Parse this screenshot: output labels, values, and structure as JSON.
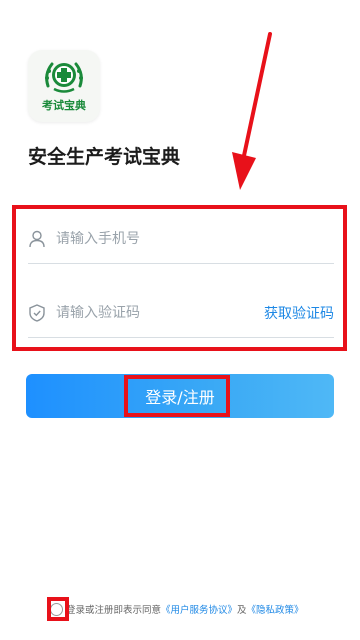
{
  "app": {
    "logo_text": "考试宝典",
    "title": "安全生产考试宝典"
  },
  "form": {
    "phone_placeholder": "请输入手机号",
    "phone_value": "",
    "code_placeholder": "请输入验证码",
    "code_value": "",
    "get_code_label": "获取验证码"
  },
  "login_button_label": "登录/注册",
  "agreement": {
    "checked": false,
    "prefix": "登录或注册即表示同意",
    "user_agreement": "《用户服务协议》",
    "conjunction": "及",
    "privacy_policy": "《隐私政策》"
  },
  "colors": {
    "accent": "#1e88e5",
    "annotation": "#e8111a",
    "logo_green": "#1a8a3a"
  },
  "icons": {
    "phone_field": "user-icon",
    "code_field": "shield-icon"
  }
}
